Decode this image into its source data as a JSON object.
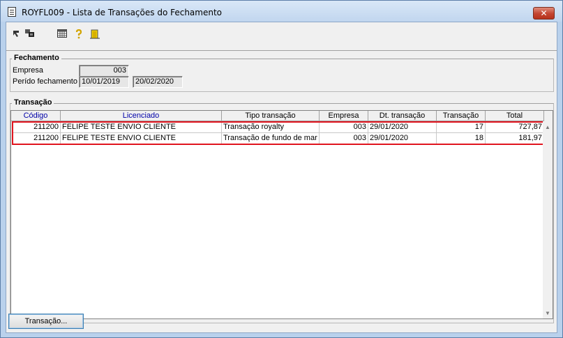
{
  "window": {
    "title": "ROYFL009 - Lista de Transações do Fechamento",
    "close_label": "✕"
  },
  "toolbar": {
    "icons": [
      "arrow-back-icon",
      "windows-icon",
      "calendar-grid-icon",
      "help-icon",
      "exit-door-icon"
    ]
  },
  "fechamento": {
    "group_title": "Fechamento",
    "empresa_label": "Empresa",
    "empresa_value": "003",
    "periodo_label": "Perído fechamento",
    "periodo_inicio": "10/01/2019",
    "periodo_fim": "20/02/2020"
  },
  "transacao": {
    "group_title": "Transação",
    "columns": [
      "Código",
      "Licenciado",
      "Tipo transação",
      "Empresa",
      "Dt. transação",
      "Transação",
      "Total"
    ],
    "rows": [
      [
        "211200",
        "FELIPE TESTE ENVIO CLIENTE",
        "Transação royalty",
        "003",
        "29/01/2020",
        "17",
        "727,87"
      ],
      [
        "211200",
        "FELIPE TESTE ENVIO CLIENTE",
        "Transação de fundo de mar",
        "003",
        "29/01/2020",
        "18",
        "181,97"
      ]
    ]
  },
  "footer": {
    "transacao_button": "Transação..."
  },
  "colors": {
    "highlight": "#e0141e",
    "header_link": "#0000a8"
  }
}
